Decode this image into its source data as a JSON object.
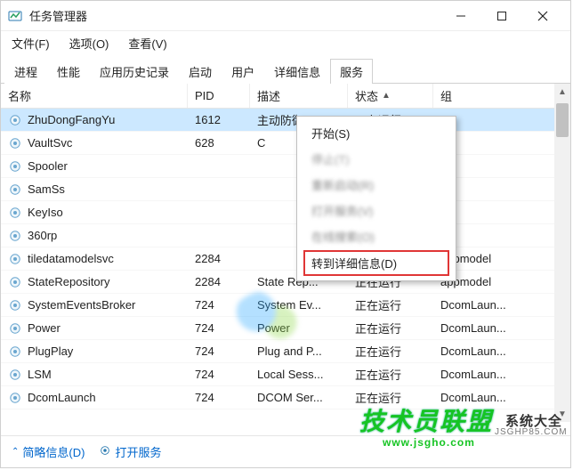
{
  "window": {
    "title": "任务管理器"
  },
  "menubar": {
    "file": "文件(F)",
    "options": "选项(O)",
    "view": "查看(V)"
  },
  "tabs": {
    "processes": "进程",
    "performance": "性能",
    "app_history": "应用历史记录",
    "startup": "启动",
    "users": "用户",
    "details": "详细信息",
    "services": "服务"
  },
  "columns": {
    "name": "名称",
    "pid": "PID",
    "desc": "描述",
    "status": "状态",
    "group": "组"
  },
  "rows": [
    {
      "name": "ZhuDongFangYu",
      "pid": "1612",
      "desc": "主动防御",
      "status": "正在运行",
      "group": ""
    },
    {
      "name": "VaultSvc",
      "pid": "628",
      "desc": "C",
      "status": "",
      "group": ""
    },
    {
      "name": "Spooler",
      "pid": "",
      "desc": "",
      "status": "",
      "group": ""
    },
    {
      "name": "SamSs",
      "pid": "",
      "desc": "",
      "status": "",
      "group": ""
    },
    {
      "name": "KeyIso",
      "pid": "",
      "desc": "",
      "status": "",
      "group": ""
    },
    {
      "name": "360rp",
      "pid": "",
      "desc": "",
      "status": "",
      "group": ""
    },
    {
      "name": "tiledatamodelsvc",
      "pid": "2284",
      "desc": "",
      "status": "",
      "group": "appmodel"
    },
    {
      "name": "StateRepository",
      "pid": "2284",
      "desc": "State Rep...",
      "status": "正在运行",
      "group": "appmodel"
    },
    {
      "name": "SystemEventsBroker",
      "pid": "724",
      "desc": "System Ev...",
      "status": "正在运行",
      "group": "DcomLaun..."
    },
    {
      "name": "Power",
      "pid": "724",
      "desc": "Power",
      "status": "正在运行",
      "group": "DcomLaun..."
    },
    {
      "name": "PlugPlay",
      "pid": "724",
      "desc": "Plug and P...",
      "status": "正在运行",
      "group": "DcomLaun..."
    },
    {
      "name": "LSM",
      "pid": "724",
      "desc": "Local Sess...",
      "status": "正在运行",
      "group": "DcomLaun..."
    },
    {
      "name": "DcomLaunch",
      "pid": "724",
      "desc": "DCOM Ser...",
      "status": "正在运行",
      "group": "DcomLaun..."
    }
  ],
  "context_menu": {
    "start": "开始(S)",
    "stop": "停止(T)",
    "restart": "重新启动(R)",
    "open": "打开服务(V)",
    "search": "在线搜索(O)",
    "goto": "转到详细信息(D)"
  },
  "statusbar": {
    "less": "简略信息(D)",
    "open_services": "打开服务"
  },
  "overlay": {
    "brand": "技术员联盟",
    "sub1": "系统大全",
    "sub2": "JSGHP85.COM",
    "url": "www.jsgho.com"
  }
}
